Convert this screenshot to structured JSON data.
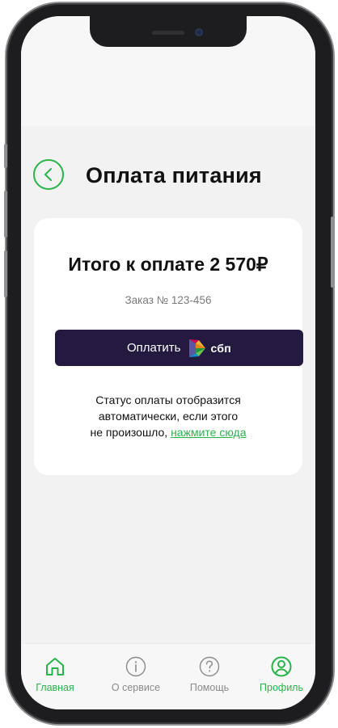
{
  "header": {
    "title": "Оплата питания"
  },
  "payment": {
    "total": "Итого к оплате 2 570₽",
    "order": "Заказ № 123-456",
    "pay_button_label": "Оплатить",
    "sbp_logo_text": "сбп",
    "status_line1": "Статус оплаты отобразится",
    "status_line2": "автоматически, если этого",
    "status_line3_prefix": "не произошло, ",
    "status_link": "нажмите сюда"
  },
  "nav": {
    "items": [
      {
        "label": "Главная",
        "icon": "home-icon",
        "active": true
      },
      {
        "label": "О сервисе",
        "icon": "info-icon",
        "active": false
      },
      {
        "label": "Помощь",
        "icon": "help-icon",
        "active": false
      },
      {
        "label": "Профиль",
        "icon": "profile-icon",
        "active": true
      }
    ]
  },
  "colors": {
    "accent": "#29b34d",
    "pay_button": "#24193f",
    "background": "#f2f2f2",
    "card": "#ffffff",
    "inactive": "#8a8a8a"
  }
}
